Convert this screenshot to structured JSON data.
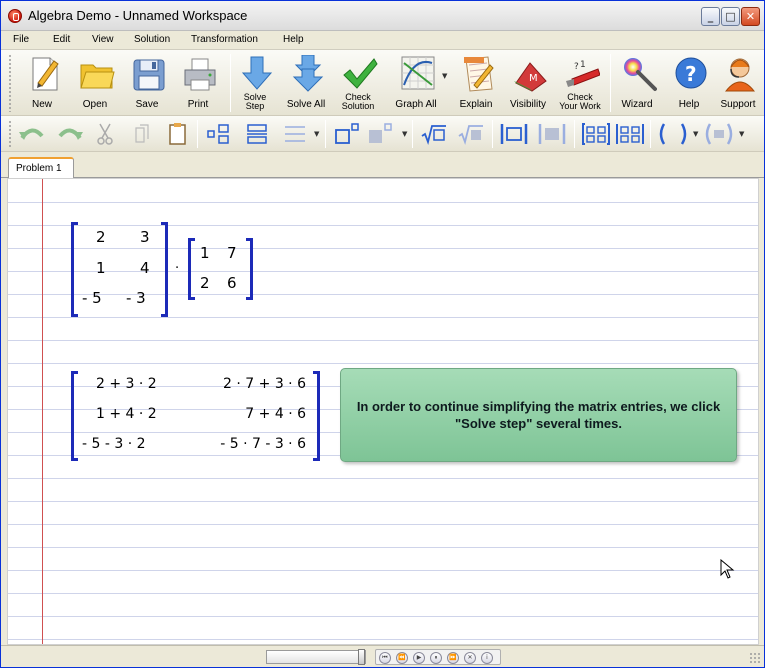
{
  "window": {
    "title": "Algebra Demo - Unnamed Workspace",
    "minimize": "_",
    "maximize": "□",
    "close": "✕"
  },
  "menu": [
    "File",
    "Edit",
    "View",
    "Solution",
    "Transformation",
    "Help"
  ],
  "toolbar": {
    "new": "New",
    "open": "Open",
    "save": "Save",
    "print": "Print",
    "solve_step": [
      "Solve",
      "Step"
    ],
    "solve_all": "Solve All",
    "check_solution": [
      "Check",
      "Solution"
    ],
    "graph_all": "Graph All",
    "explain": "Explain",
    "visibility": "Visibility",
    "check_your_work": [
      "Check",
      "Your Work"
    ],
    "wizard": "Wizard",
    "help": "Help",
    "support": "Support"
  },
  "tabs": [
    "Problem 1"
  ],
  "workspace": {
    "matrix_a": [
      [
        "2",
        "3"
      ],
      [
        "1",
        "4"
      ],
      [
        "- 5",
        "- 3"
      ]
    ],
    "matrix_b": [
      [
        "1",
        "7"
      ],
      [
        "2",
        "6"
      ]
    ],
    "product_operator": "·",
    "result_matrix": [
      [
        "2 + 3 · 2",
        "2 · 7 + 3 · 6"
      ],
      [
        "1 + 4 · 2",
        "7 + 4 · 6"
      ],
      [
        "- 5 - 3 · 2",
        "- 5 · 7 - 3 · 6"
      ]
    ],
    "hint": "In order to continue simplifying the matrix entries, we click \"Solve step\" several times."
  },
  "playback": [
    "⏮",
    "⏪",
    "▶",
    "⏸",
    "⏩",
    "✕",
    "i"
  ]
}
